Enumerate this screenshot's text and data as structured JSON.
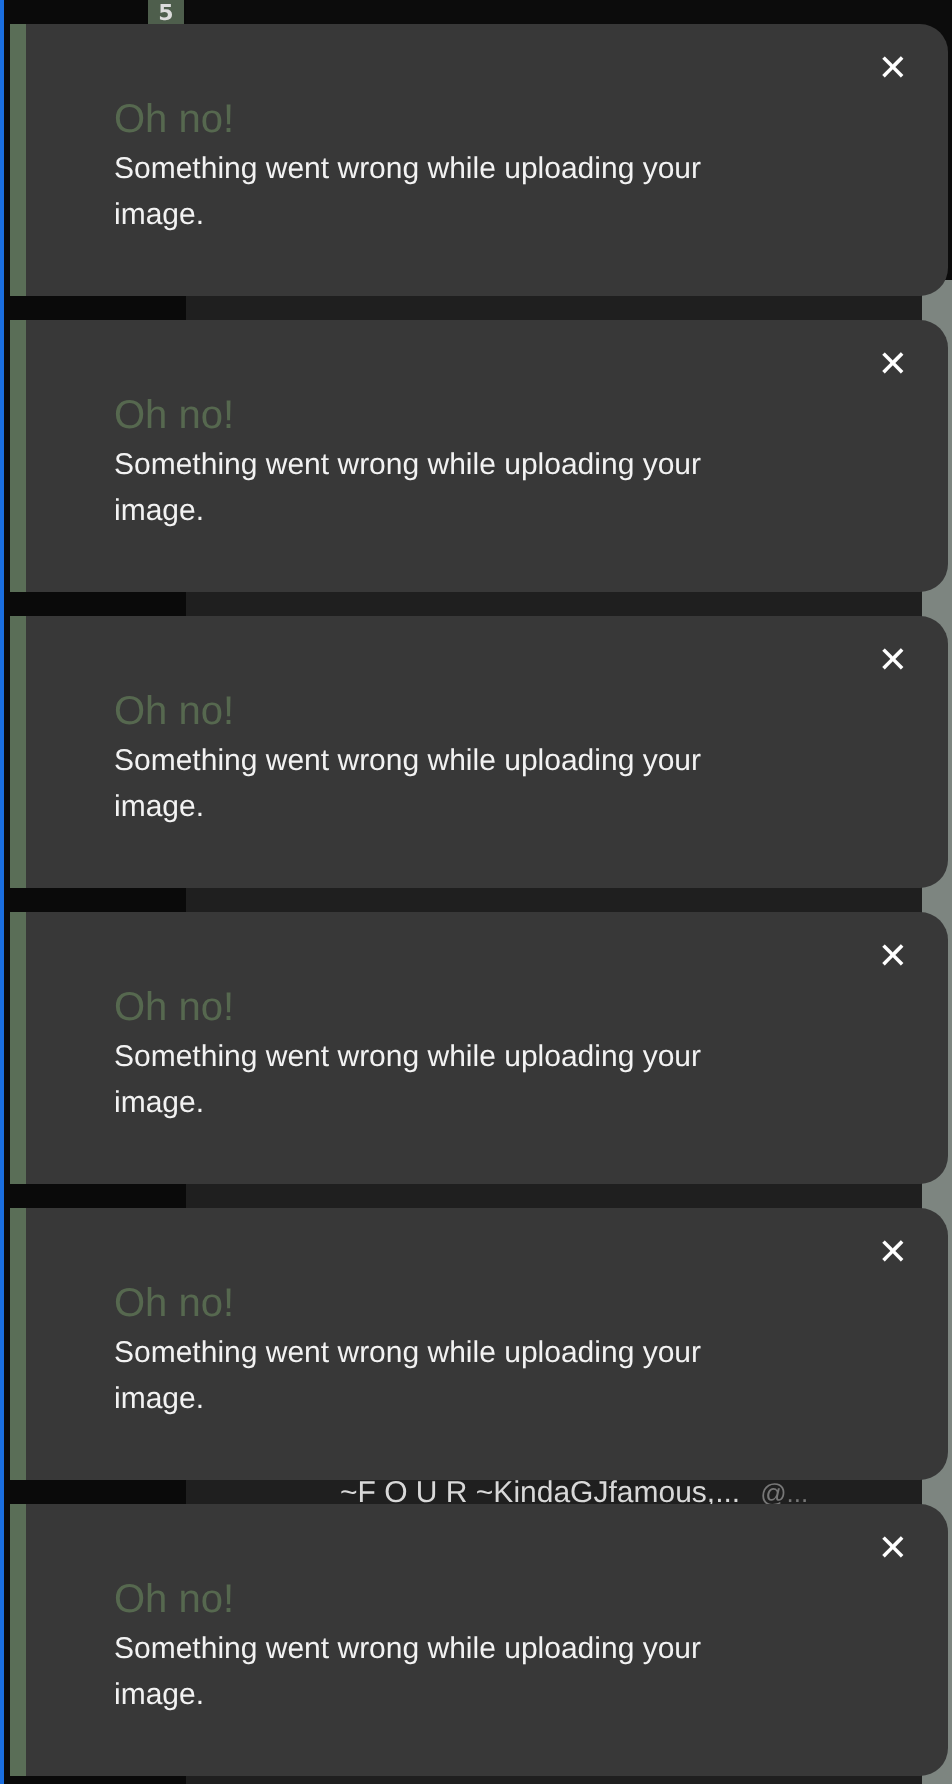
{
  "background": {
    "badge": "5",
    "row": {
      "name": "~F O U R ~KindaGJfamous,...",
      "handle": "@..."
    }
  },
  "toasts": [
    {
      "title": "Oh no!",
      "message": "Something went wrong while uploading your image.",
      "close": "✕"
    },
    {
      "title": "Oh no!",
      "message": "Something went wrong while uploading your image.",
      "close": "✕"
    },
    {
      "title": "Oh no!",
      "message": "Something went wrong while uploading your image.",
      "close": "✕"
    },
    {
      "title": "Oh no!",
      "message": "Something went wrong while uploading your image.",
      "close": "✕"
    },
    {
      "title": "Oh no!",
      "message": "Something went wrong while uploading your image.",
      "close": "✕"
    },
    {
      "title": "Oh no!",
      "message": "Something went wrong while uploading your image.",
      "close": "✕"
    }
  ]
}
